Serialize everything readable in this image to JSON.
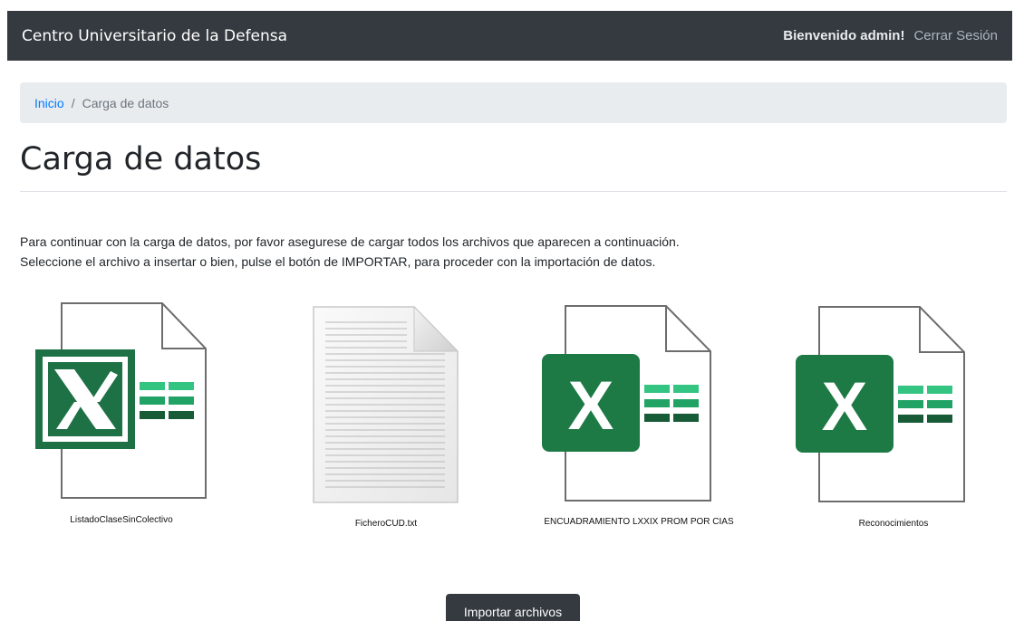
{
  "navbar": {
    "brand": "Centro Universitario de la Defensa",
    "welcome": "Bienvenido admin!",
    "logout": "Cerrar Sesión"
  },
  "breadcrumb": {
    "home": "Inicio",
    "separator": "/",
    "current": "Carga de datos"
  },
  "page": {
    "title": "Carga de datos",
    "intro_line1": "Para continuar con la carga de datos, por favor asegurese de cargar todos los archivos que aparecen a continuación.",
    "intro_line2": "Seleccione el archivo a insertar o bien, pulse el botón de IMPORTAR, para proceder con la importación de datos."
  },
  "files": [
    {
      "label": "ListadoClaseSinColectivo",
      "icon": "excel-file-icon"
    },
    {
      "label": "FicheroCUD.txt",
      "icon": "text-file-icon"
    },
    {
      "label": "ENCUADRAMIENTO LXXIX PROM POR CIAS",
      "icon": "excel-file-icon"
    },
    {
      "label": "Reconocimientos",
      "icon": "excel-file-icon"
    }
  ],
  "actions": {
    "import_label": "Importar archivos"
  },
  "colors": {
    "navbar_bg": "#343a40",
    "excel_green": "#1e7145",
    "excel_green_modern": "#1d7a45",
    "link": "#007bff"
  }
}
